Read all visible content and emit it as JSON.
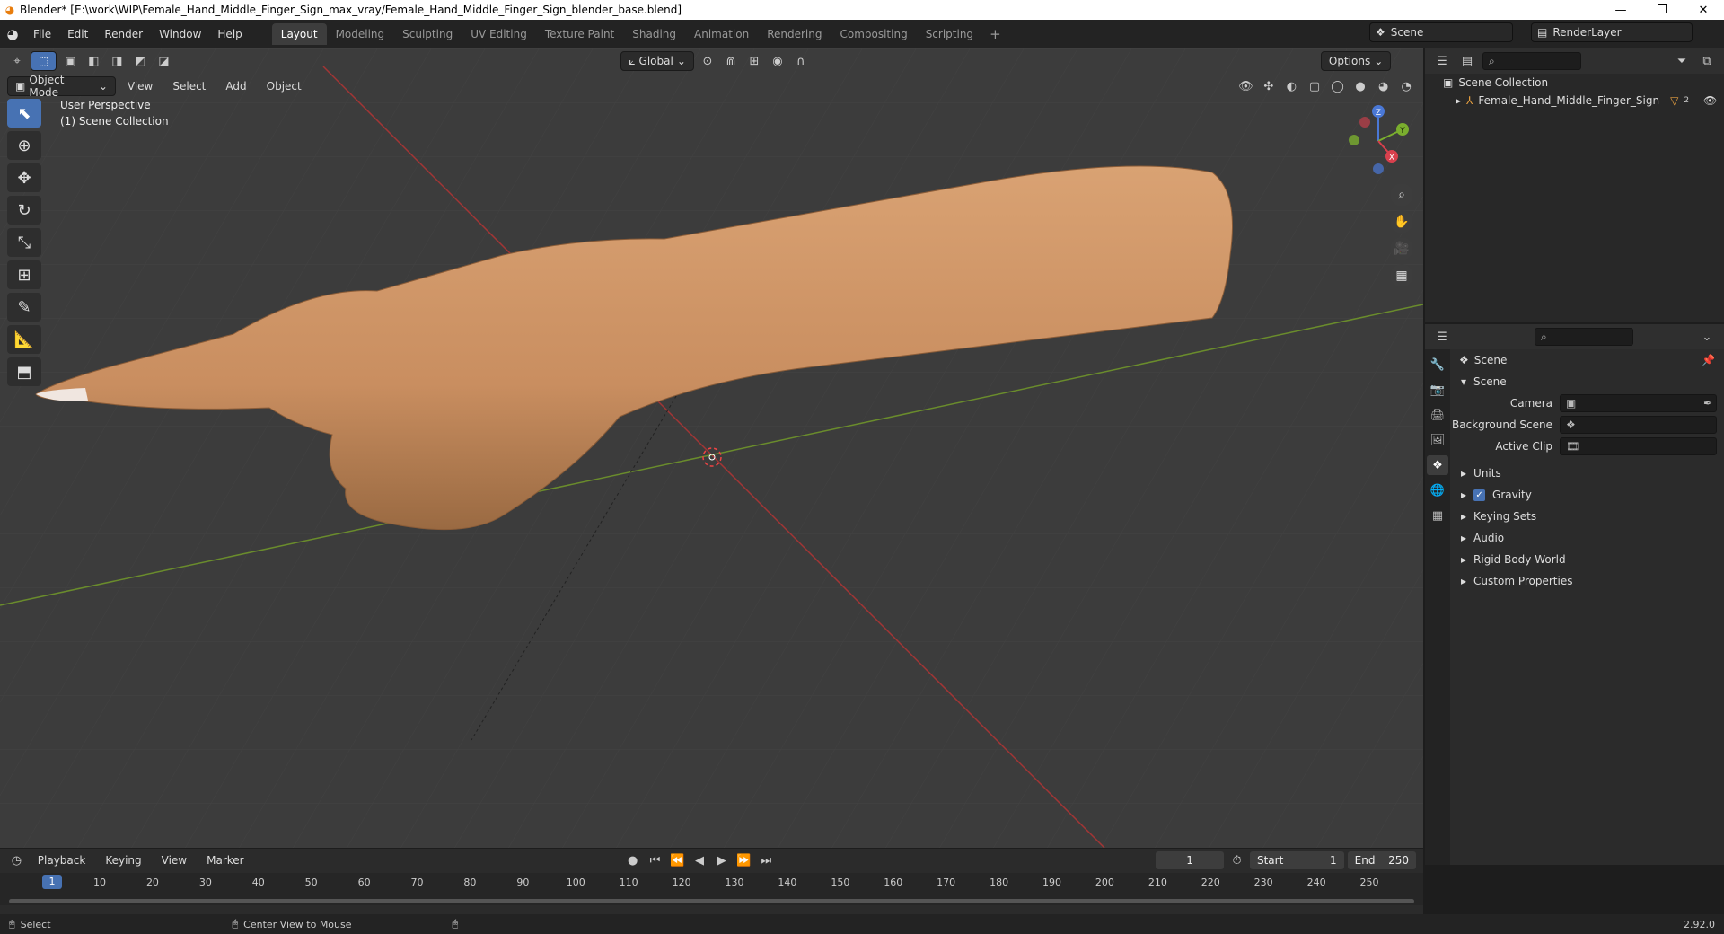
{
  "window": {
    "title": "Blender* [E:\\work\\WIP\\Female_Hand_Middle_Finger_Sign_max_vray/Female_Hand_Middle_Finger_Sign_blender_base.blend]",
    "minimize": "—",
    "maximize": "❐",
    "close": "✕"
  },
  "menus": [
    "File",
    "Edit",
    "Render",
    "Window",
    "Help"
  ],
  "workspaces": [
    "Layout",
    "Modeling",
    "Sculpting",
    "UV Editing",
    "Texture Paint",
    "Shading",
    "Animation",
    "Rendering",
    "Compositing",
    "Scripting"
  ],
  "scene_name": "Scene",
  "view_layer": "RenderLayer",
  "viewport": {
    "mode": "Object Mode",
    "menus": [
      "View",
      "Select",
      "Add",
      "Object"
    ],
    "orientation": "Global",
    "options": "Options",
    "info_line1": "User Perspective",
    "info_line2": "(1) Scene Collection",
    "gizmo": {
      "x": "X",
      "y": "Y",
      "z": "Z"
    }
  },
  "outliner": {
    "collection": "Scene Collection",
    "object": "Female_Hand_Middle_Finger_Sign",
    "object_badge": "2"
  },
  "properties": {
    "header": "Scene",
    "panel": "Scene",
    "fields": [
      {
        "label": "Camera",
        "value": ""
      },
      {
        "label": "Background Scene",
        "value": ""
      },
      {
        "label": "Active Clip",
        "value": ""
      }
    ],
    "subpanels": [
      "Units",
      "Gravity",
      "Keying Sets",
      "Audio",
      "Rigid Body World",
      "Custom Properties"
    ],
    "gravity_checked": true
  },
  "timeline": {
    "menus": [
      "Playback",
      "Keying",
      "View",
      "Marker"
    ],
    "current_frame": "1",
    "start_label": "Start",
    "start": "1",
    "end_label": "End",
    "end": "250",
    "ticks": [
      "1",
      "10",
      "20",
      "30",
      "40",
      "50",
      "60",
      "70",
      "80",
      "90",
      "100",
      "110",
      "120",
      "130",
      "140",
      "150",
      "160",
      "170",
      "180",
      "190",
      "200",
      "210",
      "220",
      "230",
      "240",
      "250"
    ]
  },
  "status": {
    "select": "Select",
    "center": "Center View to Mouse",
    "version": "2.92.0"
  }
}
